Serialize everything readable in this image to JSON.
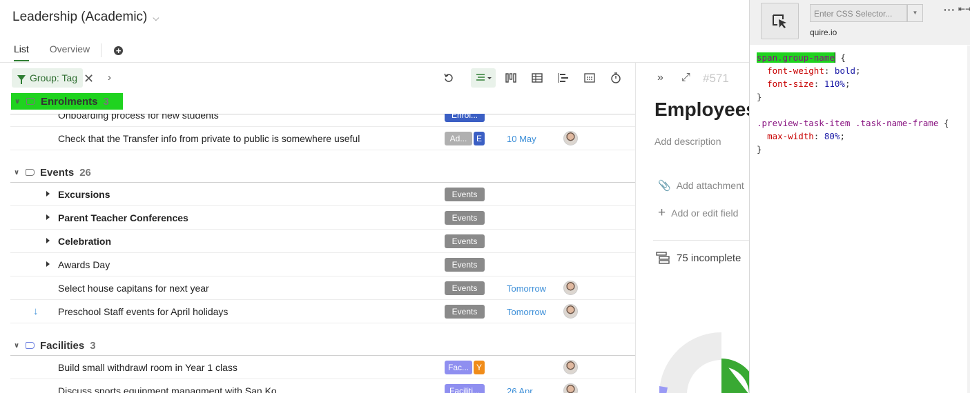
{
  "project": {
    "title": "Leadership (Academic)"
  },
  "tabs": [
    {
      "label": "List",
      "active": true
    },
    {
      "label": "Overview",
      "active": false
    }
  ],
  "filter": {
    "label": "Group: Tag"
  },
  "groups": [
    {
      "name": "Enrolments",
      "count": "3",
      "highlighted": true,
      "rows": [
        {
          "name": "Onboarding process for new students",
          "tags": [
            "Enrol..."
          ],
          "due": "",
          "avatar": false
        },
        {
          "name": "Check that the Transfer info from private to public is somewhere useful",
          "tags": [
            "Ad...",
            "E"
          ],
          "due": "10 May",
          "avatar": true
        }
      ]
    },
    {
      "name": "Events",
      "count": "26",
      "rows": [
        {
          "name": "Excursions",
          "bold": true,
          "expandable": true,
          "tags": [
            "Events"
          ]
        },
        {
          "name": "Parent Teacher Conferences",
          "bold": true,
          "expandable": true,
          "tags": [
            "Events"
          ]
        },
        {
          "name": "Celebration",
          "bold": true,
          "expandable": true,
          "tags": [
            "Events"
          ]
        },
        {
          "name": "Awards Day",
          "expandable": true,
          "tags": [
            "Events"
          ]
        },
        {
          "name": "Select house capitans for next year",
          "tags": [
            "Events"
          ],
          "due": "Tomorrow",
          "avatar": true
        },
        {
          "name": "Preschool Staff events for April holidays",
          "tags": [
            "Events"
          ],
          "due": "Tomorrow",
          "avatar": true,
          "arrow": true
        }
      ]
    },
    {
      "name": "Facilities",
      "count": "3",
      "rows": [
        {
          "name": "Build small withdrawl room in Year 1 class",
          "tags": [
            "Fac...",
            "Y"
          ],
          "avatar": true
        },
        {
          "name": "Discuss sports equipment managment with San Ko",
          "tags": [
            "Faciliti..."
          ],
          "due": "26 Apr",
          "avatar": true
        }
      ]
    }
  ],
  "preview": {
    "id": "#571",
    "title": "Employees",
    "description_placeholder": "Add description",
    "attachment_label": "Add attachment",
    "field_label": "Add or edit field",
    "incomplete_label": "75 incomplete"
  },
  "devtools": {
    "selector_placeholder": "Enter CSS Selector...",
    "site": "quire.io",
    "css_lines": [
      "span.group-name {",
      "  font-weight: bold;",
      "  font-size: 110%;",
      "}",
      "",
      ".preview-task-item .task-name-frame {",
      "  max-width: 80%;",
      "}"
    ]
  },
  "colors": {
    "accent": "#2e7d32",
    "highlight": "#1fd31f",
    "events_tag": "#8a8a8a",
    "enrol_tag": "#3b5fc4",
    "facilities_tag": "#8f8ff0",
    "y_tag": "#f08c1a",
    "admin_tag": "#b0b0b0",
    "due_blue": "#3d8fd8"
  }
}
